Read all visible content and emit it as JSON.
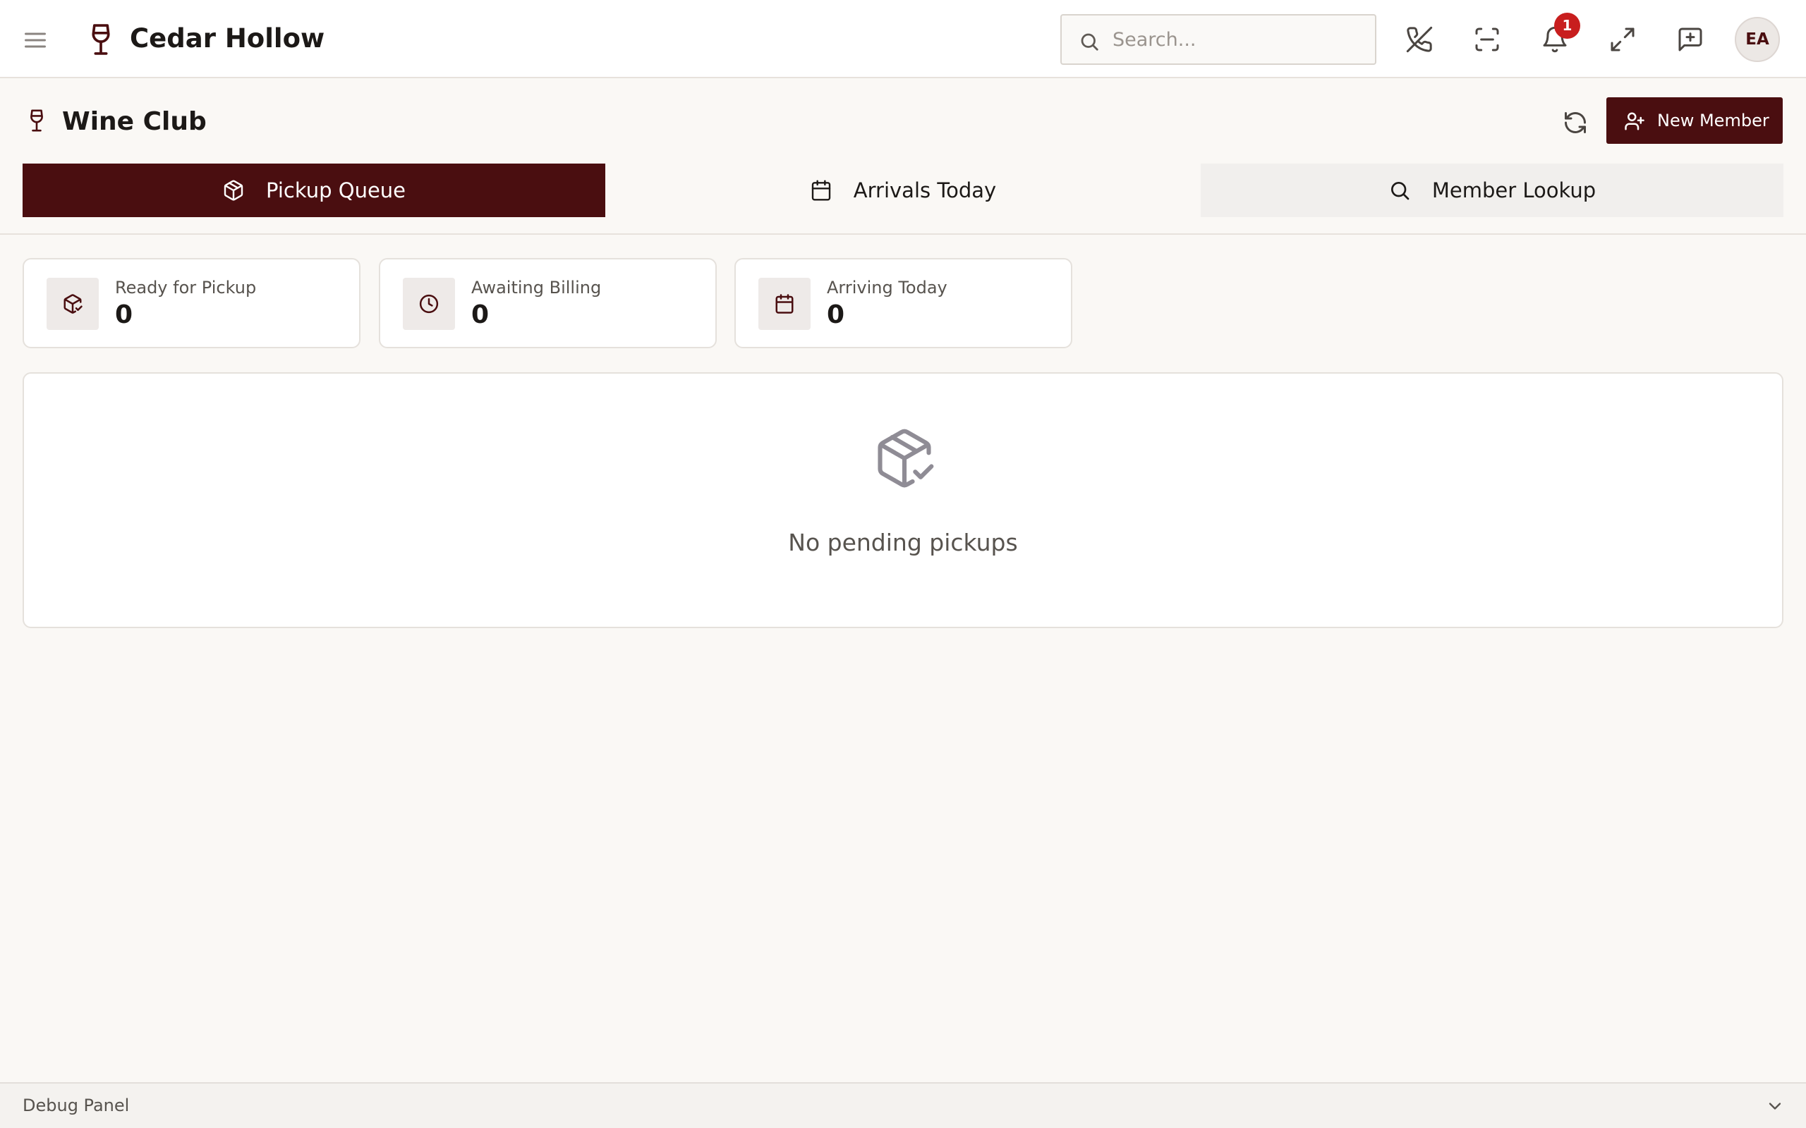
{
  "app": {
    "brand_name": "Cedar Hollow",
    "accent_color": "#4a0e10",
    "search_placeholder": "Search...",
    "notification_count": "1",
    "user_initials": "EA"
  },
  "page": {
    "title": "Wine Club",
    "new_member_label": "New Member",
    "tabs": [
      {
        "label": "Pickup Queue",
        "icon": "package-icon",
        "active": true
      },
      {
        "label": "Arrivals Today",
        "icon": "calendar-icon",
        "active": false
      },
      {
        "label": "Member Lookup",
        "icon": "search-icon",
        "active": false
      }
    ]
  },
  "stats": [
    {
      "label": "Ready for Pickup",
      "value": "0",
      "icon": "package-check-icon"
    },
    {
      "label": "Awaiting Billing",
      "value": "0",
      "icon": "clock-icon"
    },
    {
      "label": "Arriving Today",
      "value": "0",
      "icon": "calendar-icon"
    }
  ],
  "empty_state": {
    "message": "No pending pickups",
    "icon": "package-check-icon"
  },
  "debug": {
    "label": "Debug Panel"
  }
}
